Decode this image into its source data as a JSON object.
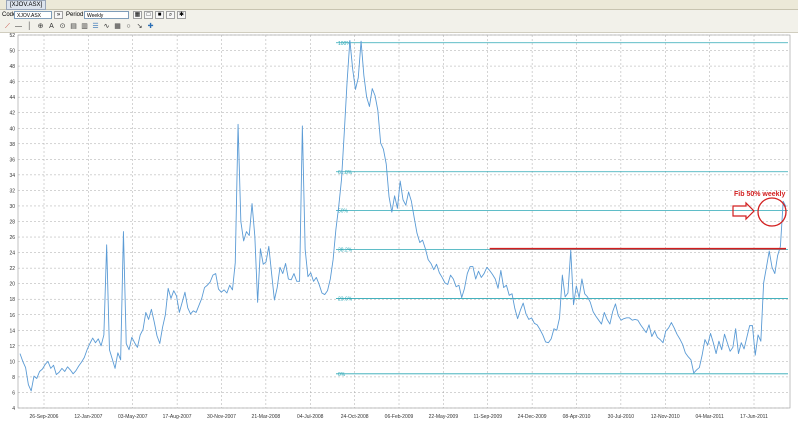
{
  "window": {
    "title": "[XJOV.ASX]"
  },
  "toolbar": {
    "code_label": "Code",
    "code_value": "XJOV.ASX",
    "period_label": "Period",
    "period_value": "Weekly",
    "tools": [
      "red-trendline-icon",
      "horizontal-line-icon",
      "vertical-line-icon",
      "crosshair-icon",
      "text-icon",
      "zoom-icon",
      "chart-type-icon",
      "candles-icon",
      "fib-icon",
      "indicator-icon",
      "circle-icon",
      "arrow-icon",
      "cross-icon"
    ]
  },
  "chart_data": {
    "type": "line",
    "title": "",
    "xlabel": "",
    "ylabel": "",
    "ylim": [
      4,
      52
    ],
    "y_ticks": [
      4,
      6,
      8,
      10,
      12,
      14,
      16,
      18,
      20,
      22,
      24,
      26,
      28,
      30,
      32,
      34,
      36,
      38,
      40,
      42,
      44,
      46,
      48,
      50,
      52
    ],
    "x_tick_labels": [
      "26-Sep-2006",
      "12-Jan-2007",
      "03-May-2007",
      "17-Aug-2007",
      "30-Nov-2007",
      "21-Mar-2008",
      "04-Jul-2008",
      "24-Oct-2008",
      "06-Feb-2009",
      "22-May-2009",
      "11-Sep-2009",
      "24-Dec-2009",
      "08-Apr-2010",
      "30-Jul-2010",
      "12-Nov-2010",
      "04-Mar-2011",
      "17-Jun-2011"
    ],
    "grid": true,
    "series": [
      {
        "color": "#5b9bd5",
        "values": [
          11,
          10,
          9.2,
          7,
          6.2,
          8.1,
          7.8,
          8.7,
          9,
          9.6,
          10,
          9.1,
          9.5,
          8.3,
          8.6,
          9.1,
          8.7,
          9.3,
          8.9,
          8.4,
          8.8,
          9.4,
          9.9,
          10.5,
          11.5,
          12.3,
          13,
          12.4,
          12.9,
          12,
          13.4,
          25,
          11.5,
          10.3,
          9.1,
          11.1,
          10.2,
          26.7,
          12.3,
          11.5,
          13.1,
          12.4,
          11.8,
          13.4,
          14.1,
          16.3,
          15.4,
          16.7,
          15.1,
          13.3,
          12.3,
          14.4,
          16,
          19.4,
          18.1,
          19.1,
          18.4,
          16.3,
          17.6,
          18.9,
          16.9,
          16.1,
          16.5,
          16.3,
          17.2,
          18.1,
          19.5,
          19.8,
          20.2,
          21.1,
          21.3,
          19.3,
          18.9,
          19.2,
          18.8,
          19.8,
          19.2,
          22.7,
          40.5,
          28,
          25.5,
          26.7,
          26.2,
          30.3,
          26.1,
          17.6,
          24.5,
          22.5,
          22.8,
          24.8,
          21.3,
          17.9,
          19.5,
          22.1,
          21.3,
          22.6,
          20.6,
          20.5,
          21.3,
          20.3,
          20.3,
          40.3,
          24.4,
          20.9,
          21.4,
          20.3,
          20.8,
          19.9,
          18.8,
          18.6,
          19.1,
          20.6,
          23.1,
          27,
          29.9,
          33.4,
          39.5,
          46,
          51.3,
          47.6,
          45,
          46.5,
          51.2,
          46.8,
          44,
          42.8,
          45.1,
          44.2,
          42.3,
          38.1,
          37.3,
          35.4,
          31.2,
          29.2,
          31.3,
          29.7,
          33.2,
          30.8,
          30.1,
          31.8,
          30.6,
          28.5,
          26.5,
          25.3,
          25.6,
          24.5,
          23.1,
          22.6,
          21.8,
          22.5,
          21.4,
          20.8,
          20.1,
          19.9,
          21.1,
          20.6,
          19.6,
          19.8,
          18.2,
          19.4,
          21.3,
          22.2,
          22.2,
          20.6,
          21.6,
          20.8,
          21.3,
          22.1,
          21.7,
          21.2,
          20.6,
          19.4,
          21.7,
          19.5,
          19.8,
          18.5,
          18.7,
          16.8,
          15.5,
          16.6,
          17.5,
          16.1,
          15.4,
          15.6,
          14.9,
          14.7,
          14.1,
          13.4,
          12.5,
          12.4,
          12.9,
          14.2,
          14,
          15.6,
          21.1,
          18.3,
          18.8,
          24.3,
          17.3,
          19.7,
          18.2,
          20.6,
          18.7,
          18.3,
          17.6,
          16.4,
          15.8,
          15.3,
          14.8,
          16.3,
          15.4,
          14.8,
          16.4,
          17.4,
          15.9,
          15.3,
          15.5,
          15.6,
          15.6,
          15.3,
          15.4,
          15.3,
          14.7,
          14.2,
          13.7,
          14.7,
          13.2,
          13.9,
          13.1,
          12.8,
          12.4,
          13.9,
          14.3,
          15,
          14.3,
          13.5,
          12.9,
          12.2,
          11.1,
          10.6,
          10.2,
          8.5,
          8.9,
          9.2,
          10.8,
          12.8,
          12.1,
          13.6,
          12.4,
          11,
          12.6,
          11.5,
          13.5,
          12.4,
          11.3,
          11.8,
          14.2,
          11,
          12.4,
          11.6,
          13.1,
          14.6,
          14.6,
          10.8,
          13.4,
          12.6,
          20.1,
          22.1,
          24.2,
          22.1,
          21.3,
          23.6,
          24.8,
          30.6,
          29.9
        ]
      }
    ],
    "fib_levels": [
      {
        "label": "100%",
        "value": 51
      },
      {
        "label": "61.8%",
        "value": 34.4
      },
      {
        "label": "50%",
        "value": 29.4
      },
      {
        "label": "38.2%",
        "value": 24.4
      },
      {
        "label": "23.6%",
        "value": 18.1
      },
      {
        "label": "0%",
        "value": 8.4
      }
    ],
    "annotation": {
      "text": "Fib 50% weekly",
      "color": "#d21f1f"
    },
    "red_line": {
      "value": 24.5,
      "x_start_index": 168,
      "color": "#d21f1f"
    }
  }
}
